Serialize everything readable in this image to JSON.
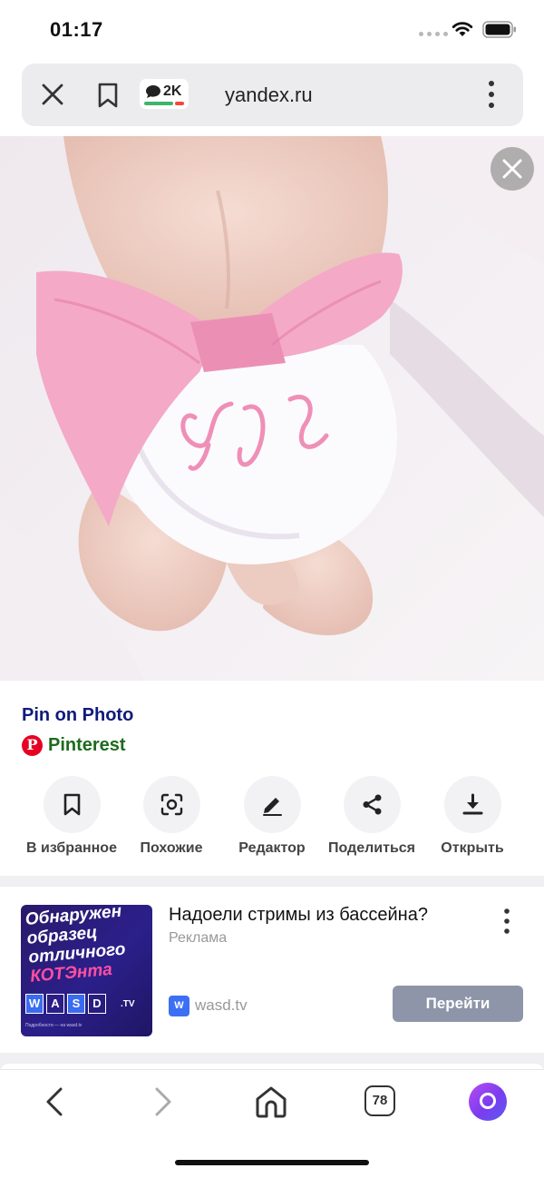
{
  "status_bar": {
    "time": "01:17"
  },
  "url_bar": {
    "comments_count": "2K",
    "domain": "yandex.ru"
  },
  "photo": {
    "alt": ""
  },
  "result": {
    "title": "Pin on Photo",
    "source": "Pinterest"
  },
  "actions": [
    {
      "label": "В избранное",
      "icon": "bookmark-icon"
    },
    {
      "label": "Похожие",
      "icon": "lens-search-icon"
    },
    {
      "label": "Редактор",
      "icon": "pencil-icon"
    },
    {
      "label": "Поделиться",
      "icon": "share-icon"
    },
    {
      "label": "Открыть",
      "icon": "download-icon"
    }
  ],
  "ad": {
    "image_lines": [
      "Обнаружен",
      "образец",
      "отличного",
      "КОТЭнта"
    ],
    "image_brand_letters": [
      "W",
      "A",
      "S",
      "D"
    ],
    "image_brand_suffix": ".TV",
    "image_fine_print": "Подробности — на wasd.tv",
    "headline": "Надоели стримы из бассейна?",
    "label": "Реклама",
    "domain_icon": "W",
    "domain": "wasd.tv",
    "cta": "Перейти"
  },
  "bottom_nav": {
    "tabs_count": "78"
  },
  "colors": {
    "title_blue": "#0f1b7a",
    "source_green": "#1d6b1d",
    "pinterest_red": "#e60023",
    "cta_gray": "#8e95a9"
  }
}
